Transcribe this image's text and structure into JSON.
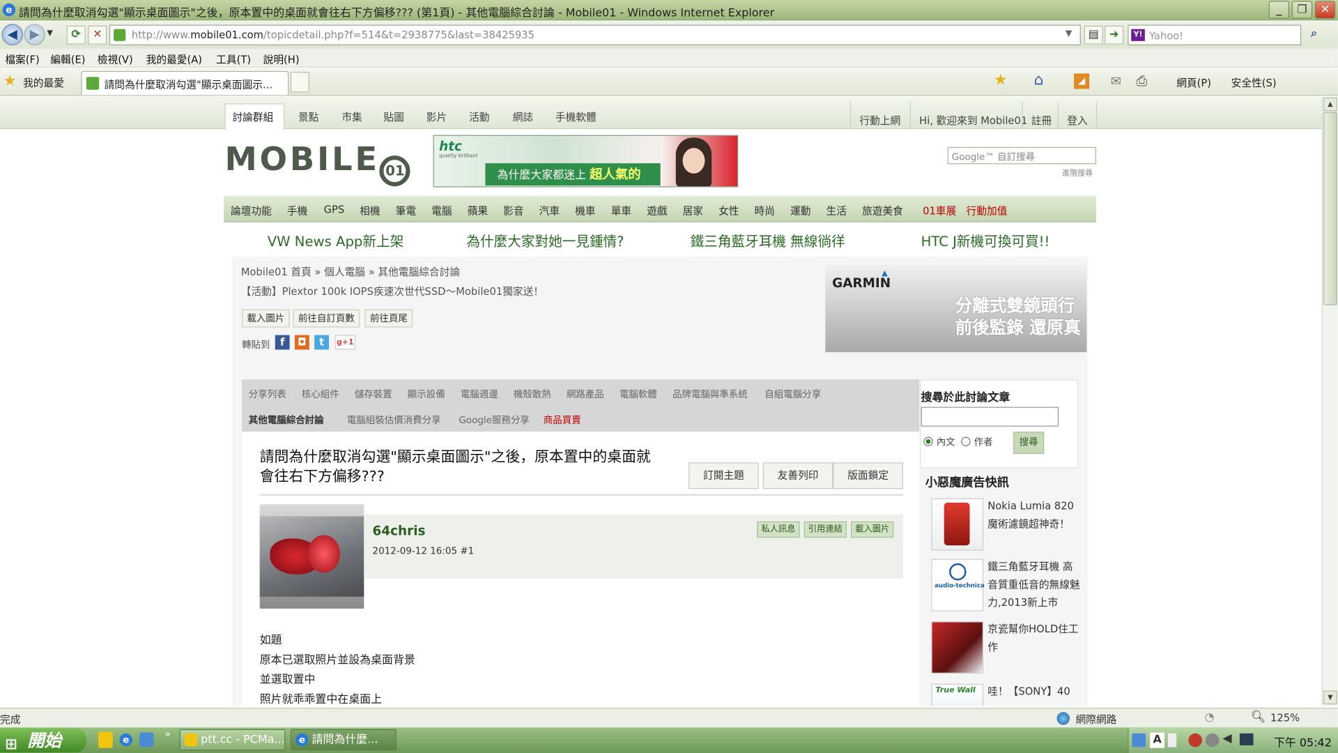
{
  "window": {
    "title": "請問為什麼取消勾選\"顯示桌面圖示\"之後，原本置中的桌面就會往右下方偏移??? (第1頁) - 其他電腦綜合討論 - Mobile01 - Windows Internet Explorer",
    "minimize": "_",
    "maximize": "❐",
    "close": "✕"
  },
  "address": {
    "url_prefix": "http://www.",
    "url_domain": "mobile01.com",
    "url_path": "/topicdetail.php?f=514&t=2938775&last=38425935",
    "search_placeholder": "Yahoo!"
  },
  "menu": [
    "檔案(F)",
    "編輯(E)",
    "檢視(V)",
    "我的最愛(A)",
    "工具(T)",
    "說明(H)"
  ],
  "favbar": {
    "favorites": "我的最愛",
    "tab_title": "請問為什麼取消勾選\"顯示桌面圖示...",
    "page_menu": "網頁(P)",
    "safety_menu": "安全性(S)"
  },
  "site": {
    "topnav": [
      "討論群組",
      "景點",
      "市集",
      "貼圖",
      "影片",
      "活動",
      "網誌",
      "手機軟體"
    ],
    "mobile_login": "行動上網",
    "welcome": "Hi, 歡迎來到 Mobile01",
    "register": "註冊",
    "login": "登入",
    "logo": "MOBILE",
    "logo_mark": "01",
    "ad_brand": "htc",
    "ad_tagline": "quietly brilliant",
    "ad_text": "為什麼大家都迷上",
    "ad_text_bold": "超人氣的",
    "google_placeholder": "Google™ 自訂搜尋",
    "advanced_search": "進階搜尋",
    "categories": [
      "論壇功能",
      "手機",
      "GPS",
      "相機",
      "筆電",
      "電腦",
      "蘋果",
      "影音",
      "汽車",
      "機車",
      "單車",
      "遊戲",
      "居家",
      "女性",
      "時尚",
      "運動",
      "生活",
      "旅遊美食",
      "01車展",
      "行動加值"
    ],
    "promos": [
      "VW News App新上架",
      "為什麼大家對她一見鍾情?",
      "鐵三角藍牙耳機 無線徜徉",
      "HTC J新機可換可買!!"
    ],
    "breadcrumb": "Mobile01 首頁 » 個人電腦 » 其他電腦綜合討論",
    "activity": "【活動】Plextor 100k IOPS疾速次世代SSD～Mobile01獨家送！",
    "small_buttons": [
      "載入圖片",
      "前往自訂頁數",
      "前往頁尾"
    ],
    "share_label": "轉貼到",
    "share_icons": [
      "f",
      "◘",
      "t",
      "g+1"
    ],
    "garmin": "GARMIN",
    "garmin_line1": "分離式雙鏡頭行",
    "garmin_line2": "前後監錄 還原真",
    "forum_row1": [
      "分享列表",
      "核心組件",
      "儲存裝置",
      "顯示設備",
      "電腦週邊",
      "機殼散熱",
      "網路產品",
      "電腦軟體",
      "品牌電腦與準系統",
      "自組電腦分享"
    ],
    "forum_row2_current": "其他電腦綜合討論",
    "forum_row2": [
      "電腦組裝估價消費分享",
      "Google服務分享"
    ],
    "forum_row2_red": "商品買賣",
    "post_title": "請問為什麼取消勾選\"顯示桌面圖示\"之後，原本置中的桌面就會往右下方偏移???",
    "topic_buttons": [
      "訂閱主題",
      "友善列印",
      "版面鎖定"
    ],
    "username": "64chris",
    "post_meta": "2012-09-12 16:05 #1",
    "user_buttons": [
      "私人訊息",
      "引用連結",
      "載入圖片"
    ],
    "post_lines": [
      "如題",
      "原本已選取照片並設為桌面背景",
      "並選取置中",
      "照片就乖乖置中在桌面上"
    ],
    "side_search_title": "搜尋於此討論文章",
    "radio_content": "內文",
    "radio_author": "作者",
    "side_search_button": "搜尋",
    "ad_section_title": "小惡魔廣告快訊",
    "ads": [
      {
        "text": "Nokia Lumia 820 魔術濾鏡超神奇！"
      },
      {
        "text": "鐵三角藍牙耳機 高音質重低音的無線魅力,2013新上市",
        "img": "audio-technica"
      },
      {
        "text": "京瓷幫你HOLD住工作"
      },
      {
        "text": "哇！【SONY】40",
        "img": "True Wall"
      }
    ]
  },
  "status": {
    "left": "完成",
    "zone": "網際網路",
    "zoom": "125%"
  },
  "taskbar": {
    "start": "開始",
    "tasks": [
      "ptt.cc - PCMa...",
      "請問為什麼..."
    ],
    "clock": "下午 05:42"
  }
}
